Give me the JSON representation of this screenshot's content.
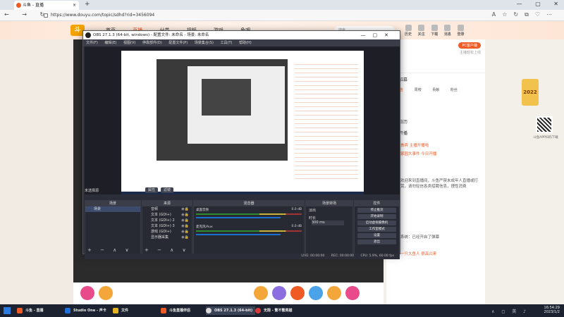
{
  "browser": {
    "tab_title": "斗鱼 - 直播",
    "tab_close": "×",
    "new_tab": "+",
    "url": "https://www.douyu.com/topic/sdhd?rid=3456094",
    "nav": "← → ↻",
    "toolbar": "A☆↻⧉♡⋯",
    "win_ctrl": [
      "—",
      "▢",
      "✕"
    ]
  },
  "site": {
    "logo": "斗",
    "nav": [
      "首页",
      "直播",
      "分类",
      "视频",
      "游戏",
      "鱼吧"
    ],
    "active_nav": 1,
    "search_placeholder": "搜索",
    "user_menu": [
      "历史",
      "关注",
      "下载",
      "消息",
      "登录"
    ],
    "pc_badge": "PC客户端",
    "pc_sub": "主播轻松上线",
    "panel_items": [
      "主播招募",
      "主播日历",
      "今日开播"
    ],
    "panel_tabs": [
      "公告",
      "周榜",
      "贡献",
      "粉丝"
    ],
    "chat": [
      {
        "text": "贵宾 主播开播啦",
        "hl": true
      },
      {
        "text": "家园大事件 今日开播",
        "hl": true
      },
      {
        "text": "欢迎来到直播间，斗鱼严禁未成年人直播或打赏，请勿轻信各类招聘信息，理性消费",
        "hl": false
      },
      {
        "text": "系统：已经开启了弹幕",
        "hl": false
      },
      {
        "text": "一只大鱼人 很高兴来",
        "hl": true
      }
    ],
    "decor_year": "2022",
    "app_label": "斗鱼APP扫码下载"
  },
  "obs": {
    "title": "OBS 27.1.3 (64-bit, windows) - 配置文件: 未命名 - 场景: 未命名",
    "win_ctrl": [
      "—",
      "▢",
      "✕"
    ],
    "menu": [
      "文件(F)",
      "编辑(E)",
      "视图(V)",
      "停靠部件(D)",
      "配置文件(P)",
      "场景集合(S)",
      "工具(T)",
      "帮助(H)"
    ],
    "no_source": "未选择源",
    "scene_btns": [
      "属性",
      "滤镜"
    ],
    "docks": {
      "scenes": {
        "title": "场景",
        "items": [
          "场景"
        ]
      },
      "sources": {
        "title": "来源",
        "items": [
          "音频",
          "文本 (GDI+)",
          "文本 (GDI+) 2",
          "文本 (GDI+) 3",
          "游戏 (GDI+)",
          "显示器采集"
        ]
      },
      "mixer": {
        "title": "混音器",
        "rows": [
          {
            "name": "桌面音频",
            "db": "0.0 dB"
          },
          {
            "name": "麦克风/Aux",
            "db": "0.0 dB"
          }
        ]
      },
      "transitions": {
        "title": "场景转场",
        "type": "淡出",
        "duration_label": "时长",
        "duration": "300 ms"
      },
      "controls": {
        "title": "控件",
        "buttons": [
          "停止推流",
          "开始录制",
          "启动虚拟摄像机",
          "工作室模式",
          "设置",
          "退出"
        ]
      }
    },
    "dock_footer": "+ − ∧ ∨",
    "status": [
      "LIVE: 00:00:00",
      "REC: 00:00:00",
      "CPU: 5.9%, 60.00 fps"
    ]
  },
  "taskbar": {
    "tasks": [
      {
        "label": "斗鱼 - 直播",
        "color": "#f05a24",
        "active": false
      },
      {
        "label": "Studio One - 声卡",
        "color": "#1e6fd8",
        "active": false
      },
      {
        "label": "文件",
        "color": "#e6b422",
        "active": false
      },
      {
        "label": "斗鱼直播伴侣",
        "color": "#f05a24",
        "active": false
      },
      {
        "label": "OBS 27.1.3 (64-bit)",
        "color": "#d8d8d8",
        "active": true
      },
      {
        "label": "无限 - 繁不繁英雄",
        "color": "#d83a3a",
        "active": false
      }
    ],
    "tray": "∧ ◻ 英 ♪",
    "time": "16:54:29",
    "date": "2023/1/2"
  }
}
